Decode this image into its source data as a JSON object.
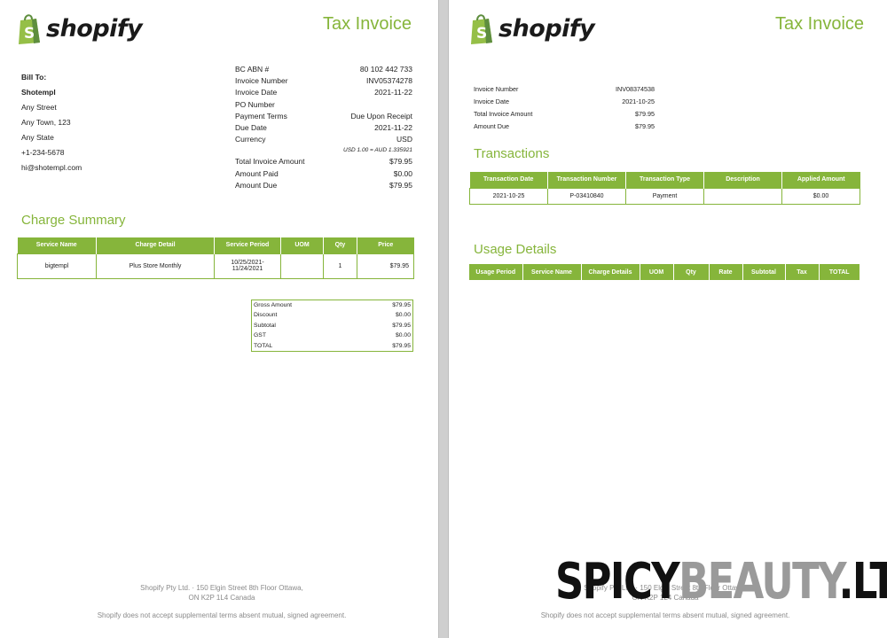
{
  "brand": {
    "name": "shopify",
    "accent": "#86b53b"
  },
  "page1": {
    "title": "Tax Invoice",
    "bill_to": {
      "label": "Bill To:",
      "name": "Shotempl",
      "street": "Any Street",
      "town": "Any Town, 123",
      "state": "Any State",
      "phone": "+1-234-5678",
      "email": "hi@shotempl.com"
    },
    "meta": [
      {
        "label": "BC ABN #",
        "value": "80 102 442 733"
      },
      {
        "label": "Invoice Number",
        "value": "INV05374278"
      },
      {
        "label": "Invoice Date",
        "value": "2021-11-22"
      },
      {
        "label": "PO Number",
        "value": ""
      },
      {
        "label": "Payment Terms",
        "value": "Due Upon Receipt"
      },
      {
        "label": "Due Date",
        "value": "2021-11-22"
      },
      {
        "label": "Currency",
        "value": "USD"
      }
    ],
    "fx_note": "USD 1.00 = AUD 1.335921",
    "amounts": [
      {
        "label": "Total Invoice Amount",
        "value": "$79.95"
      },
      {
        "label": "Amount Paid",
        "value": "$0.00"
      },
      {
        "label": "Amount Due",
        "value": "$79.95"
      }
    ],
    "charge_summary": {
      "title": "Charge Summary",
      "headers": [
        "Service Name",
        "Charge Detail",
        "Service Period",
        "UOM",
        "Qty",
        "Price"
      ],
      "rows": [
        [
          "bigtempl",
          "Plus Store Monthly",
          "10/25/2021-11/24/2021",
          "",
          "1",
          "$79.95"
        ]
      ]
    },
    "totals": [
      {
        "label": "Gross Amount",
        "value": "$79.95"
      },
      {
        "label": "Discount",
        "value": "$0.00"
      },
      {
        "label": "Subtotal",
        "value": "$79.95"
      },
      {
        "label": "GST",
        "value": "$0.00"
      },
      {
        "label": "TOTAL",
        "value": "$79.95"
      }
    ],
    "footer": {
      "address_line1": "Shopify Pty Ltd. · 150 Elgin Street 8th Floor Ottawa,",
      "address_line2": "ON K2P 1L4 Canada",
      "disclaimer": "Shopify does not accept supplemental terms absent mutual, signed agreement."
    }
  },
  "page2": {
    "title": "Tax Invoice",
    "meta": [
      {
        "label": "Invoice Number",
        "value": "INV08374538"
      },
      {
        "label": "Invoice Date",
        "value": "2021-10-25"
      },
      {
        "label": "Total Invoice Amount",
        "value": "$79.95"
      },
      {
        "label": "Amount Due",
        "value": "$79.95"
      }
    ],
    "transactions": {
      "title": "Transactions",
      "headers": [
        "Transaction Date",
        "Transaction Number",
        "Transaction Type",
        "Description",
        "Applied Amount"
      ],
      "rows": [
        [
          "2021-10-25",
          "P-03410840",
          "Payment",
          "",
          "$0.00"
        ]
      ]
    },
    "usage_details": {
      "title": "Usage Details",
      "headers": [
        "Usage Period",
        "Service Name",
        "Charge Details",
        "UOM",
        "Qty",
        "Rate",
        "Subtotal",
        "Tax",
        "TOTAL"
      ]
    },
    "footer": {
      "address_line1": "Shopify Pty Ltd. · 150 Elgin Street 8th Floor Ottawa,",
      "address_line2": "ON K2P 1L4 Canada",
      "disclaimer": "Shopify does not accept supplemental terms absent mutual, signed agreement."
    }
  },
  "watermark": {
    "part1": "SPICY",
    "part2": "BEAUTY",
    "part3": ".LT"
  }
}
